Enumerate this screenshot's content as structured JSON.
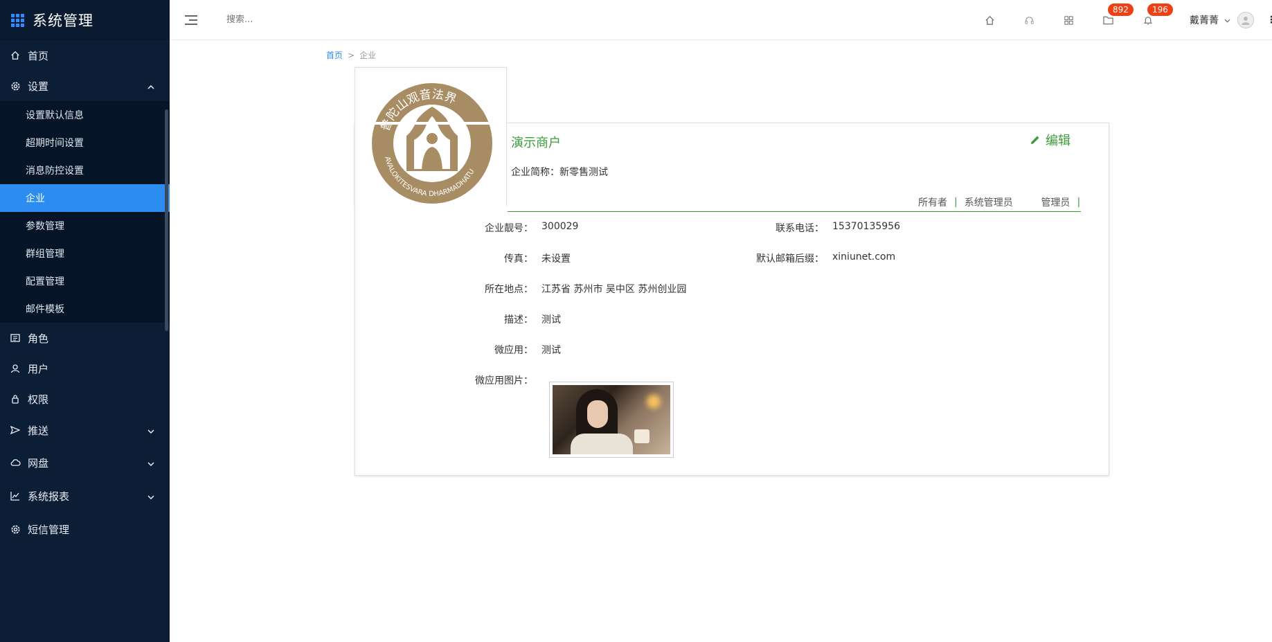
{
  "app": {
    "title": "系统管理"
  },
  "topbar": {
    "search_placeholder": "搜索...",
    "badges": {
      "messages": "892",
      "notifications": "196"
    },
    "user_name": "戴菁菁"
  },
  "sidebar": {
    "home": "首页",
    "settings": "设置",
    "settings_items": [
      "设置默认信息",
      "超期时间设置",
      "消息防控设置",
      "企业",
      "参数管理",
      "群组管理",
      "配置管理",
      "邮件模板"
    ],
    "role": "角色",
    "user": "用户",
    "permission": "权限",
    "push": "推送",
    "disk": "网盘",
    "reports": "系统报表",
    "sms": "短信管理"
  },
  "breadcrumb": {
    "home": "首页",
    "separator": ">",
    "current": "企业"
  },
  "enterprise": {
    "name": "演示商户",
    "edit_label": "编辑",
    "short_name_label": "企业简称：",
    "short_name": "新零售测试",
    "roles": [
      "所有者",
      "系统管理员",
      "管理员"
    ],
    "fields": {
      "number_label": "企业靓号：",
      "number": "300029",
      "phone_label": "联系电话：",
      "phone": "15370135956",
      "fax_label": "传真：",
      "fax": "未设置",
      "email_label": "默认邮箱后缀：",
      "email": "xiniunet.com",
      "location_label": "所在地点：",
      "location": "江苏省 苏州市 吴中区 苏州创业园",
      "desc_label": "描述：",
      "desc": "测试",
      "microapp_label": "微应用：",
      "microapp": "测试",
      "microapp_image_label": "微应用图片："
    },
    "logo_text": "普陀山观音法界 AVALOKITESVARA DHARMADHATU"
  },
  "colors": {
    "sidebar_bg": "#0c1e36",
    "active": "#2d8cf0",
    "accent_green": "#3a9d3a",
    "badge": "#ed4014"
  }
}
